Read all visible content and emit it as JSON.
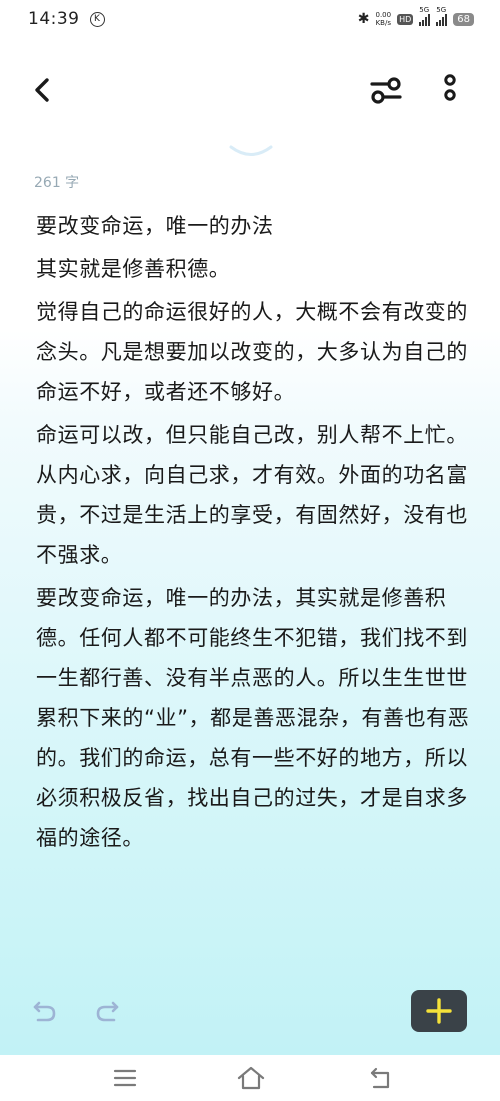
{
  "status_bar": {
    "time": "14:39",
    "k_badge": "K",
    "bluetooth": "✱",
    "net_speed_value": "0.00",
    "net_speed_unit": "KB/s",
    "hd_label": "HD",
    "sim1_label": "5G",
    "sim2_label": "5G",
    "battery": "68"
  },
  "toolbar": {
    "back_icon": "chevron-left-icon",
    "filter_icon": "sliders-icon",
    "more_icon": "more-vertical-icon"
  },
  "editor": {
    "word_count": "261 字",
    "paragraphs": [
      "要改变命运，唯一的办法",
      "其实就是修善积德。",
      "觉得自己的命运很好的人，大概不会有改变的念头。凡是想要加以改变的，大多认为自己的命运不好，或者还不够好。",
      "命运可以改，但只能自己改，别人帮不上忙。从内心求，向自己求，才有效。外面的功名富贵，不过是生活上的享受，有固然好，没有也不强求。",
      "要改变命运，唯一的办法，其实就是修善积德。任何人都不可能终生不犯错，我们找不到一生都行善、没有半点恶的人。所以生生世世累积下来的“业”，都是善恶混杂，有善也有恶的。我们的命运，总有一些不好的地方，所以必须积极反省，找出自己的过失，才是自求多福的途径。"
    ]
  },
  "bottom_tools": {
    "undo_icon": "undo-icon",
    "redo_icon": "redo-icon",
    "add_icon": "plus-icon",
    "add_color": "#f5e23a"
  },
  "nav_bar": {
    "menu_icon": "menu-icon",
    "home_icon": "home-icon",
    "back_icon": "back-icon"
  }
}
